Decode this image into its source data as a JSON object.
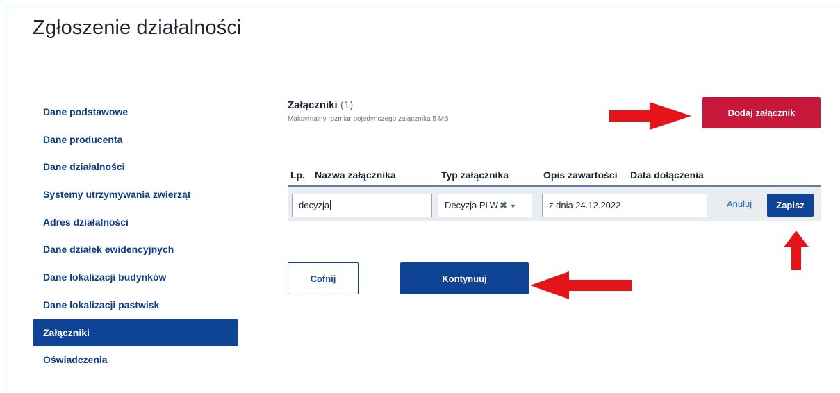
{
  "page": {
    "title": "Zgłoszenie działalności"
  },
  "sidebar": {
    "items": [
      {
        "label": "Dane podstawowe"
      },
      {
        "label": "Dane producenta"
      },
      {
        "label": "Dane działalności"
      },
      {
        "label": "Systemy utrzymywania zwierząt"
      },
      {
        "label": "Adres działalności"
      },
      {
        "label": "Dane działek ewidencyjnych"
      },
      {
        "label": "Dane lokalizacji budynków"
      },
      {
        "label": "Dane lokalizacji pastwisk"
      },
      {
        "label": "Załączniki",
        "active": true
      },
      {
        "label": "Oświadczenia"
      }
    ]
  },
  "attachments": {
    "title": "Załączniki",
    "count": "(1)",
    "subtitle": "Maksymalny rozmiar pojedynczego załącznika 5 MB",
    "add_button": "Dodaj załącznik"
  },
  "table": {
    "headers": {
      "lp": "Lp.",
      "name": "Nazwa załącznika",
      "type": "Typ załącznika",
      "desc": "Opis zawartości",
      "date": "Data dołączenia"
    },
    "edit_row": {
      "name_value": "decyzja",
      "type_value": "Decyzja PLW",
      "desc_value": "z dnia 24.12.2022",
      "cancel_label": "Anuluj",
      "save_label": "Zapisz"
    }
  },
  "nav": {
    "back_label": "Cofnij",
    "continue_label": "Kontynuuj"
  },
  "colors": {
    "primary": "#0e4396",
    "accent_red": "#c8183a",
    "arrow_red": "#e5141b"
  },
  "icons": {
    "clear": "close-icon",
    "caret": "chevron-down-icon",
    "annotation": "red-arrow-icon"
  }
}
